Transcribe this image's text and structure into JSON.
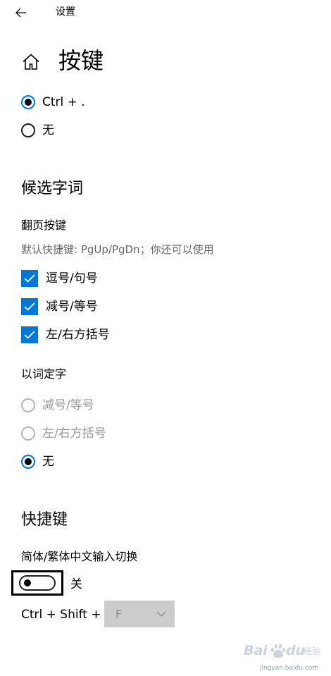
{
  "window": {
    "title": "设置",
    "back_icon": "arrow-left-icon"
  },
  "header": {
    "title": "按键",
    "home_icon": "home-icon"
  },
  "mode_switch": {
    "options": [
      {
        "label": "Ctrl + .",
        "checked": true,
        "disabled": false
      },
      {
        "label": "无",
        "checked": false,
        "disabled": false
      }
    ]
  },
  "candidates": {
    "heading": "候选字词",
    "page_keys": {
      "title": "翻页按键",
      "description": "默认快捷键: PgUp/PgDn；你还可以使用",
      "options": [
        {
          "label": "逗号/句号",
          "checked": true
        },
        {
          "label": "减号/等号",
          "checked": true
        },
        {
          "label": "左/右方括号",
          "checked": true
        }
      ]
    },
    "word_select": {
      "title": "以词定字",
      "options": [
        {
          "label": "减号/等号",
          "checked": false,
          "disabled": true
        },
        {
          "label": "左/右方括号",
          "checked": false,
          "disabled": true
        },
        {
          "label": "无",
          "checked": true,
          "disabled": false
        }
      ]
    }
  },
  "hotkeys": {
    "heading": "快捷键",
    "switch_title": "简体/繁体中文输入切换",
    "toggle_state": "关",
    "toggle_on": false,
    "shortcut_text": "Ctrl + Shift +",
    "key_value": "F",
    "dropdown_icon": "chevron-down-icon"
  },
  "watermark": {
    "brand": "Baidu 经验",
    "url": "jingyan.baidu.com"
  },
  "colors": {
    "accent": "#0078d7",
    "disabled": "#9a9a9a",
    "description": "#666666",
    "select_bg": "#cccccc"
  }
}
